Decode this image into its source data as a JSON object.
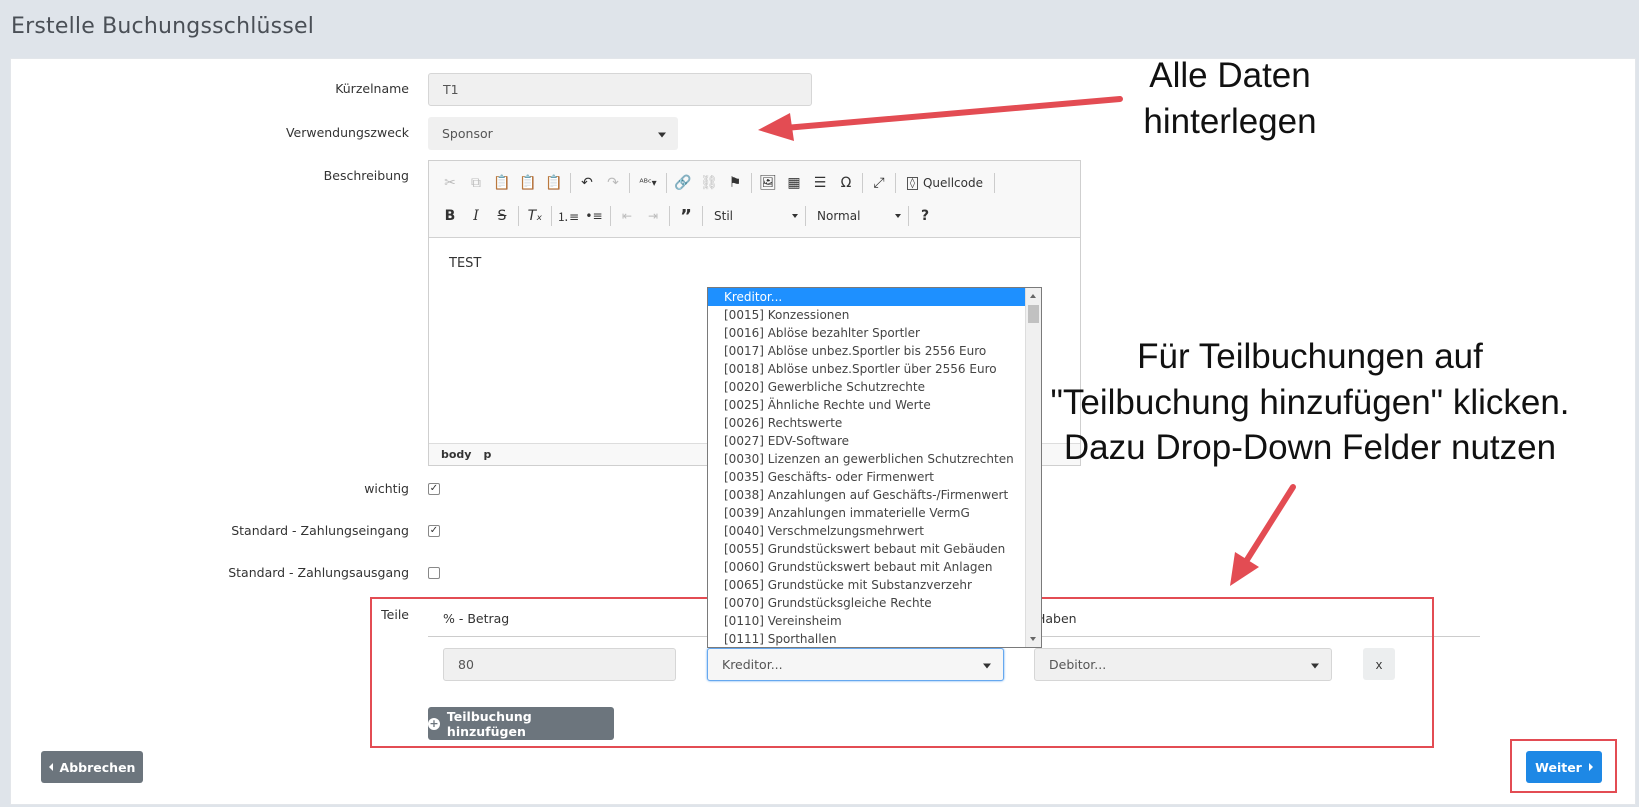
{
  "page": {
    "title": "Erstelle Buchungsschlüssel"
  },
  "form": {
    "kuerzelname": {
      "label": "Kürzelname",
      "value": "T1"
    },
    "verwendungszweck": {
      "label": "Verwendungszweck",
      "value": "Sponsor"
    },
    "beschreibung": {
      "label": "Beschreibung",
      "content": "TEST",
      "toolbar": {
        "source_label": "Quellcode",
        "style_combo": "Stil",
        "format_combo": "Normal",
        "help": "?"
      },
      "status_path": [
        "body",
        "p"
      ]
    },
    "wichtig": {
      "label": "wichtig",
      "checked": true
    },
    "standard_eingang": {
      "label": "Standard - Zahlungseingang",
      "checked": true
    },
    "standard_ausgang": {
      "label": "Standard - Zahlungsausgang",
      "checked": false
    }
  },
  "teile": {
    "label": "Teile",
    "col_betrag": "% - Betrag",
    "col_haben": "Haben",
    "row": {
      "betrag": "80",
      "soll": "Kreditor...",
      "haben": "Debitor...",
      "remove": "x"
    },
    "add_button": "Teilbuchung hinzufügen"
  },
  "dropdown": {
    "items": [
      "Kreditor...",
      "[0015] Konzessionen",
      "[0016] Ablöse bezahlter Sportler",
      "[0017] Ablöse unbez.Sportler bis 2556 Euro",
      "[0018] Ablöse unbez.Sportler über 2556 Euro",
      "[0020] Gewerbliche Schutzrechte",
      "[0025] Ähnliche Rechte und Werte",
      "[0026] Rechtswerte",
      "[0027] EDV-Software",
      "[0030] Lizenzen an gewerblichen Schutzrechten",
      "[0035] Geschäfts- oder Firmenwert",
      "[0038] Anzahlungen auf Geschäfts-/Firmenwert",
      "[0039] Anzahlungen immaterielle VermG",
      "[0040] Verschmelzungsmehrwert",
      "[0055] Grundstückswert bebaut mit Gebäuden",
      "[0060] Grundstückswert bebaut mit Anlagen",
      "[0065] Grundstücke mit Substanzverzehr",
      "[0070] Grundstücksgleiche Rechte",
      "[0110] Vereinsheim",
      "[0111] Sporthallen"
    ],
    "selected_index": 0
  },
  "footer": {
    "cancel": "Abbrechen",
    "next": "Weiter"
  },
  "annotations": {
    "top": [
      "Alle Daten",
      "hinterlegen"
    ],
    "middle": [
      "Für Teilbuchungen auf",
      "\"Teilbuchung hinzufügen\" klicken.",
      "Dazu Drop-Down Felder nutzen"
    ]
  },
  "colors": {
    "accent": "#1e88e5",
    "highlight": "#e34c53",
    "secondary": "#6c757d"
  }
}
